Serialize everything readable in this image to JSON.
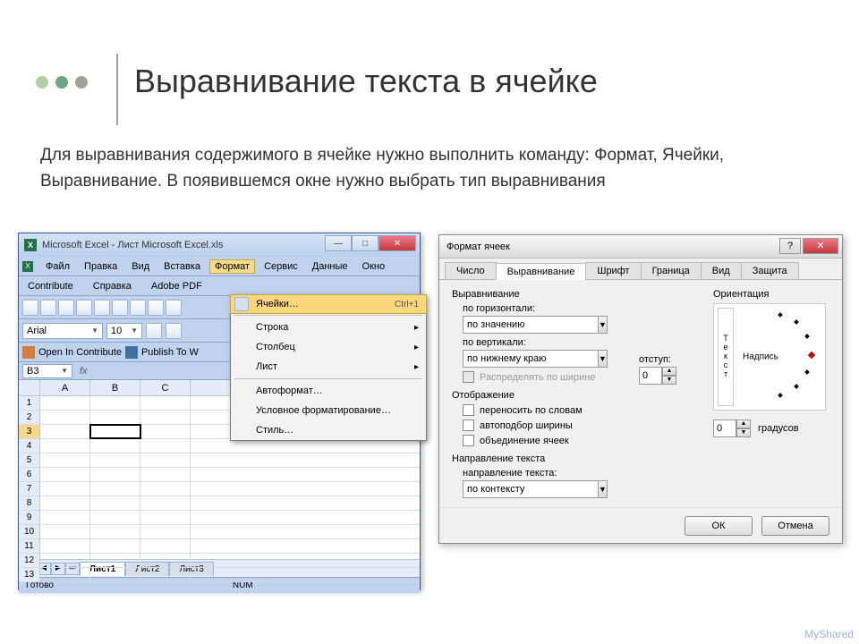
{
  "slide": {
    "title": "Выравнивание текста в ячейке",
    "body": "Для выравнивания содержимого в ячейке нужно выполнить команду: Формат, Ячейки, Выравнивание. В появившемся окне нужно выбрать тип выравнивания"
  },
  "excel": {
    "title": "Microsoft Excel - Лист Microsoft Excel.xls",
    "menu": [
      "Файл",
      "Правка",
      "Вид",
      "Вставка",
      "Формат",
      "Сервис",
      "Данные",
      "Окно"
    ],
    "menu2": [
      "Contribute",
      "Справка",
      "Adobe PDF"
    ],
    "font": "Arial",
    "size": "10",
    "contribute_open": "Open In Contribute",
    "contribute_publish": "Publish To W",
    "cellref": "B3",
    "columns": [
      "A",
      "B",
      "C"
    ],
    "rows": [
      "1",
      "2",
      "3",
      "4",
      "5",
      "6",
      "7",
      "8",
      "9",
      "10",
      "11",
      "12",
      "13"
    ],
    "selected_row": "3",
    "sheets": [
      "Лист1",
      "Лист2",
      "Лист3"
    ],
    "status_ready": "Готово",
    "status_num": "NUM",
    "format_menu": {
      "cells": "Ячейки…",
      "cells_shortcut": "Ctrl+1",
      "row": "Строка",
      "column": "Столбец",
      "sheet": "Лист",
      "autoformat": "Автоформат…",
      "conditional": "Условное форматирование…",
      "style": "Стиль…"
    }
  },
  "dialog": {
    "title": "Формат ячеек",
    "tabs": [
      "Число",
      "Выравнивание",
      "Шрифт",
      "Граница",
      "Вид",
      "Защита"
    ],
    "active_tab": 1,
    "section_align": "Выравнивание",
    "horiz_label": "по горизонтали:",
    "horiz_value": "по значению",
    "vert_label": "по вертикали:",
    "vert_value": "по нижнему краю",
    "indent_label": "отступ:",
    "indent_value": "0",
    "distribute": "Распределять по ширине",
    "section_display": "Отображение",
    "wrap": "переносить по словам",
    "autofit": "автоподбор ширины",
    "merge": "объединение ячеек",
    "section_direction": "Направление текста",
    "direction_label": "направление текста:",
    "direction_value": "по контексту",
    "orientation_label": "Ориентация",
    "orient_vert_text": "Текст",
    "orient_caption": "Надпись",
    "degrees_value": "0",
    "degrees_label": "градусов",
    "ok": "ОК",
    "cancel": "Отмена"
  },
  "watermark": "MyShared"
}
